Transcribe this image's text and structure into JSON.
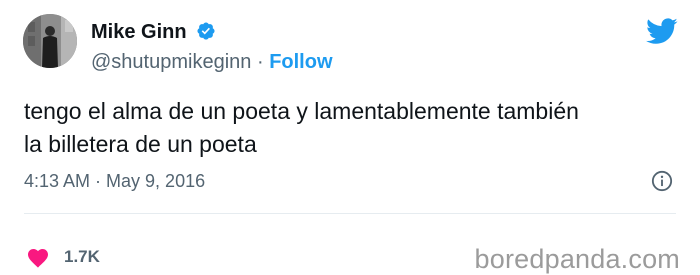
{
  "tweet": {
    "author": {
      "display_name": "Mike Ginn",
      "handle": "@shutupmikeginn",
      "separator": "·",
      "follow_label": "Follow"
    },
    "text": "tengo el alma de un poeta y lamentablemente también\nla billetera de un poeta",
    "timestamp": "4:13 AM · May 9, 2016",
    "like_count": "1.7K"
  },
  "icons": {
    "verified": "verified-badge-icon",
    "platform": "twitter-bird-icon",
    "info": "info-icon",
    "like": "heart-icon"
  },
  "colors": {
    "accent": "#1d9bf0",
    "like": "#f91880",
    "secondary_text": "#536471",
    "watermark": "#9b9b9b"
  },
  "watermark": "boredpanda.com"
}
